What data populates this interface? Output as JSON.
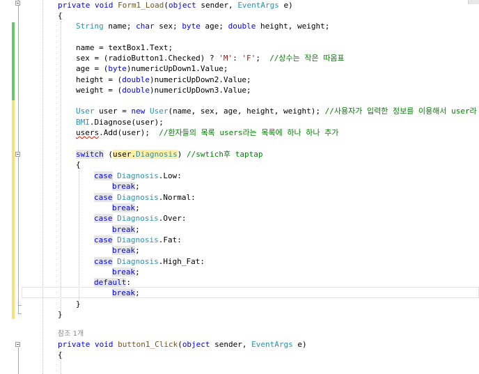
{
  "editor": {
    "lines": {
      "l0_a": "private void ",
      "l0_b": "Form1_Load",
      "l0_c": "(",
      "l0_d": "object",
      "l0_e": " sender, ",
      "l0_f": "EventArgs",
      "l0_g": " e)",
      "l1": "{",
      "l2_a": "String",
      "l2_b": " name; ",
      "l2_c": "char",
      "l2_d": " sex; ",
      "l2_e": "byte",
      "l2_f": " age; ",
      "l2_g": "double",
      "l2_h": " height, weight;",
      "l3": "name = textBox1.Text;",
      "l4_a": "sex = (radioButton1.Checked) ? ",
      "l4_b": "'M'",
      "l4_c": ": ",
      "l4_d": "'F'",
      "l4_e": ";  ",
      "l4_f": "//상수는 작은 따옴표",
      "l5_a": "age = (",
      "l5_b": "byte",
      "l5_c": ")numericUpDown1.Value;",
      "l6_a": "height = (",
      "l6_b": "double",
      "l6_c": ")numericUpDown2.Value;",
      "l7_a": "weight = (",
      "l7_b": "double",
      "l7_c": ")numericUpDown3.Value;",
      "l8_a": "User",
      "l8_b": " user = ",
      "l8_c": "new",
      "l8_d": " ",
      "l8_e": "User",
      "l8_f": "(name, sex, age, height, weight); ",
      "l8_g": "//사용자가 입력한 정보를 이용해서 user라",
      "l9_a": "BMI",
      "l9_b": ".Diagnose(user);",
      "l10_a": "users",
      "l10_b": ".Add(user);  ",
      "l10_c": "//환자들의 목록 users라는 목록에 하나 하나 추가",
      "l11_a": "switch",
      "l11_b": " (",
      "l11_c": "user.",
      "l11_d": "Diagnosis",
      "l11_e": ") ",
      "l11_f": "//swtich후 taptap",
      "l12": "{",
      "case": "case",
      "diag": "Diagnosis",
      "low": ".Low:",
      "normal": ".Normal:",
      "over": ".Over:",
      "fat": ".Fat:",
      "high_fat": ".High_Fat:",
      "brk": "break",
      "semi": ";",
      "default": "default",
      "colon": ":",
      "l24": "}",
      "l25": "}",
      "ref_count": "참조 1개",
      "l27_a": "private void ",
      "l27_b": "button1_Click",
      "l27_c": "(",
      "l27_d": "object",
      "l27_e": " sender, ",
      "l27_f": "EventArgs",
      "l27_g": " e)",
      "l28": "{"
    },
    "colors": {
      "keyword": "#0000ff",
      "type": "#2b91af",
      "comment": "#008000",
      "string": "#a31515",
      "method": "#74531f",
      "saved_change": "#6ac66a",
      "unsaved_change": "#f5e178"
    }
  }
}
